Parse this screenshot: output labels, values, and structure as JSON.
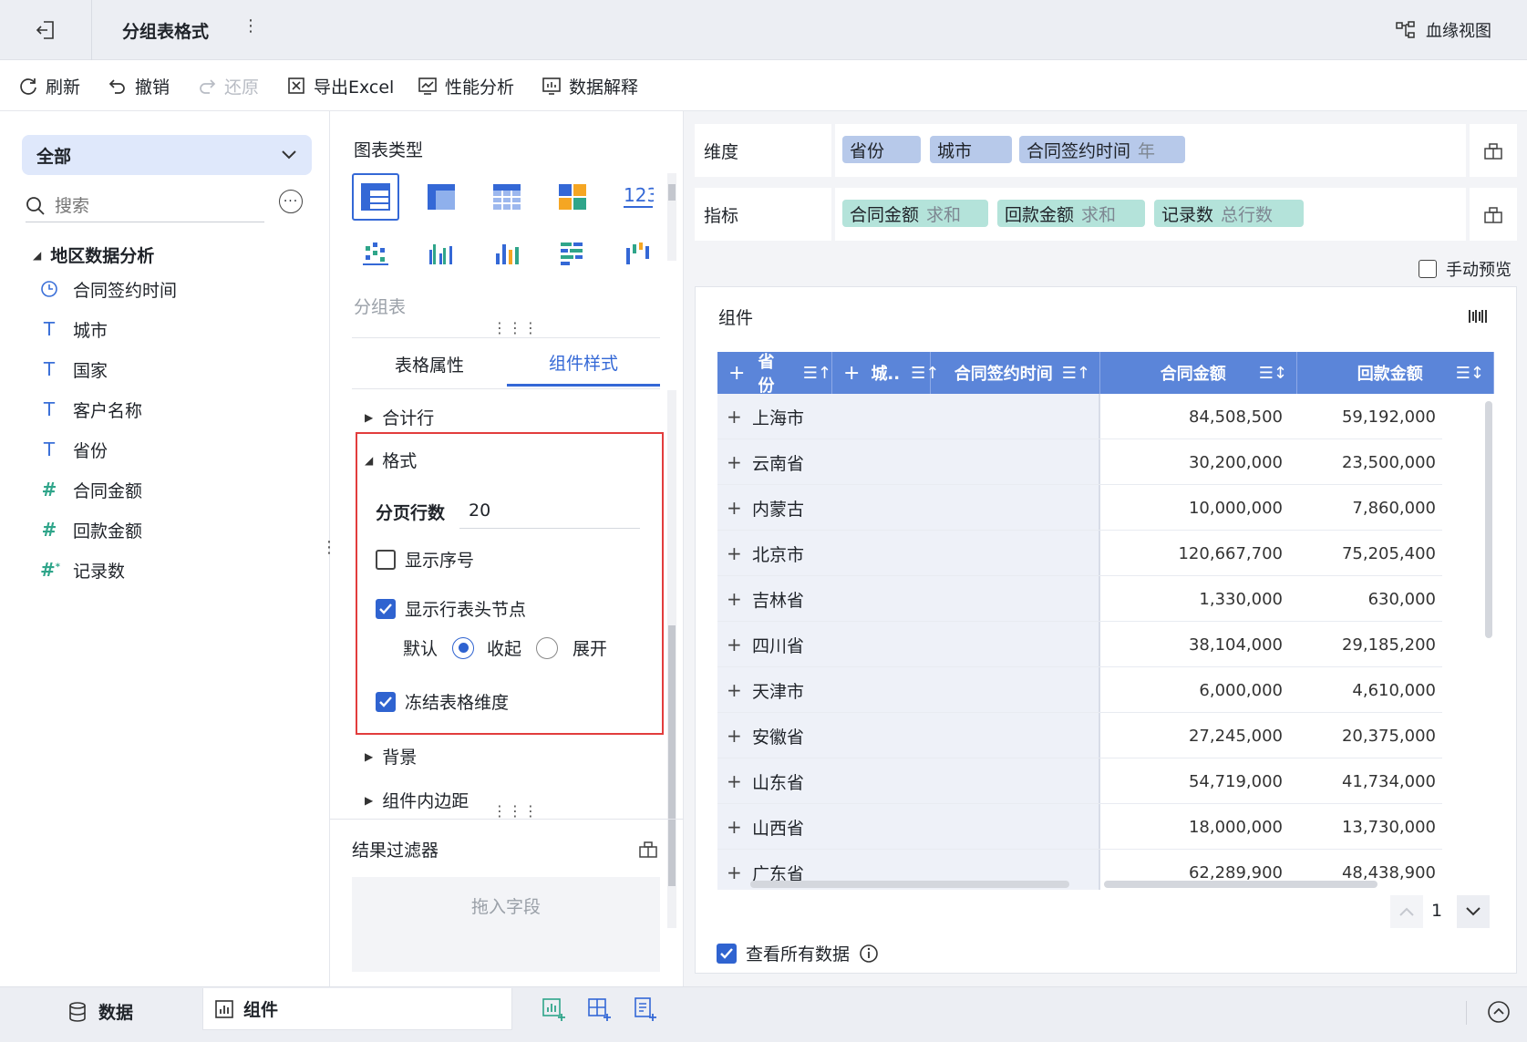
{
  "header": {
    "title": "分组表格式",
    "lineage_label": "血缘视图"
  },
  "toolbar": {
    "refresh": "刷新",
    "undo": "撤销",
    "redo": "还原",
    "export": "导出Excel",
    "performance": "性能分析",
    "explain": "数据解释"
  },
  "left": {
    "dataset_select": "全部",
    "search_placeholder": "搜索",
    "folder": "地区数据分析",
    "fields": [
      {
        "icon": "clock-icon",
        "label": "合同签约时间"
      },
      {
        "icon": "text-icon",
        "label": "城市"
      },
      {
        "icon": "text-icon",
        "label": "国家"
      },
      {
        "icon": "text-icon",
        "label": "客户名称"
      },
      {
        "icon": "text-icon",
        "label": "省份"
      },
      {
        "icon": "number-icon",
        "label": "合同金额"
      },
      {
        "icon": "number-icon",
        "label": "回款金额"
      },
      {
        "icon": "calc-number-icon",
        "label": "记录数"
      }
    ]
  },
  "middle": {
    "chart_type_heading": "图表类型",
    "chart_type_selected": "分组表",
    "tabs": [
      "表格属性",
      "组件样式"
    ],
    "active_tab": "组件样式",
    "sections": {
      "total_row": "合计行",
      "format": "格式",
      "page_rows_label": "分页行数",
      "page_rows_value": "20",
      "show_index": "显示序号",
      "show_index_checked": false,
      "show_row_header_nodes": "显示行表头节点",
      "show_row_header_nodes_checked": true,
      "default_label": "默认",
      "collapse_label": "收起",
      "expand_label": "展开",
      "default_selected": "收起",
      "freeze_dims": "冻结表格维度",
      "freeze_dims_checked": true,
      "background": "背景",
      "padding": "组件内边距"
    },
    "result_filter": {
      "title": "结果过滤器",
      "drop_placeholder": "拖入字段"
    }
  },
  "right": {
    "dimension_label": "维度",
    "dimensions": [
      {
        "name": "省份",
        "agg": ""
      },
      {
        "name": "城市",
        "agg": ""
      },
      {
        "name": "合同签约时间",
        "agg": "年"
      }
    ],
    "indicator_label": "指标",
    "indicators": [
      {
        "name": "合同金额",
        "agg": "求和"
      },
      {
        "name": "回款金额",
        "agg": "求和"
      },
      {
        "name": "记录数",
        "agg": "总行数"
      }
    ],
    "manual_preview": "手动预览",
    "component_title": "组件",
    "table": {
      "headers": [
        "省份",
        "城..",
        "合同签约时间",
        "合同金额",
        "回款金额"
      ],
      "rows": [
        {
          "province": "上海市",
          "contract": "84,508,500",
          "payment": "59,192,000"
        },
        {
          "province": "云南省",
          "contract": "30,200,000",
          "payment": "23,500,000"
        },
        {
          "province": "内蒙古",
          "contract": "10,000,000",
          "payment": "7,860,000"
        },
        {
          "province": "北京市",
          "contract": "120,667,700",
          "payment": "75,205,400"
        },
        {
          "province": "吉林省",
          "contract": "1,330,000",
          "payment": "630,000"
        },
        {
          "province": "四川省",
          "contract": "38,104,000",
          "payment": "29,185,200"
        },
        {
          "province": "天津市",
          "contract": "6,000,000",
          "payment": "4,610,000"
        },
        {
          "province": "安徽省",
          "contract": "27,245,000",
          "payment": "20,375,000"
        },
        {
          "province": "山东省",
          "contract": "54,719,000",
          "payment": "41,734,000"
        },
        {
          "province": "山西省",
          "contract": "18,000,000",
          "payment": "13,730,000"
        },
        {
          "province": "广东省",
          "contract": "62,289,900",
          "payment": "48,438,900"
        }
      ]
    },
    "page_number": "1",
    "view_all_data": "查看所有数据"
  },
  "bottom": {
    "data_tab": "数据",
    "component_tab": "组件"
  },
  "colors": {
    "accent": "#3468d6",
    "table_header": "#5b85d9",
    "dimension_pill": "#b7c9ea",
    "indicator_pill": "#b4e3da",
    "highlight_border": "#e23d3d"
  }
}
